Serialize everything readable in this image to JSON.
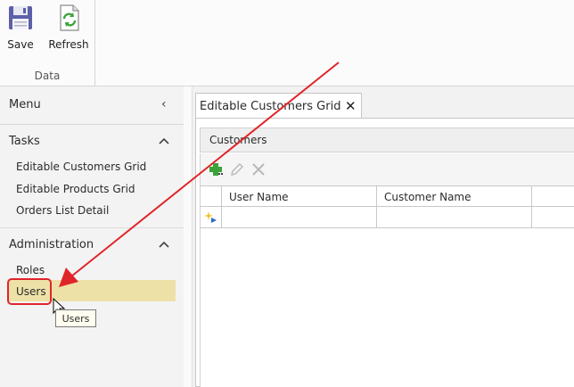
{
  "ribbon": {
    "save_label": "Save",
    "refresh_label": "Refresh",
    "group_label": "Data"
  },
  "menu": {
    "title": "Menu",
    "sections": [
      {
        "title": "Tasks",
        "items": [
          "Editable Customers Grid",
          "Editable Products Grid",
          "Orders List Detail"
        ]
      },
      {
        "title": "Administration",
        "items": [
          "Roles",
          "Users"
        ]
      }
    ],
    "tooltip": "Users"
  },
  "main": {
    "tab_label": "Editable Customers Grid",
    "panel_title": "Customers",
    "columns": [
      "User Name",
      "Customer Name"
    ]
  },
  "colors": {
    "highlight": "#eee1a8",
    "annotation": "#e0242b",
    "add_icon": "#3aa33a"
  }
}
